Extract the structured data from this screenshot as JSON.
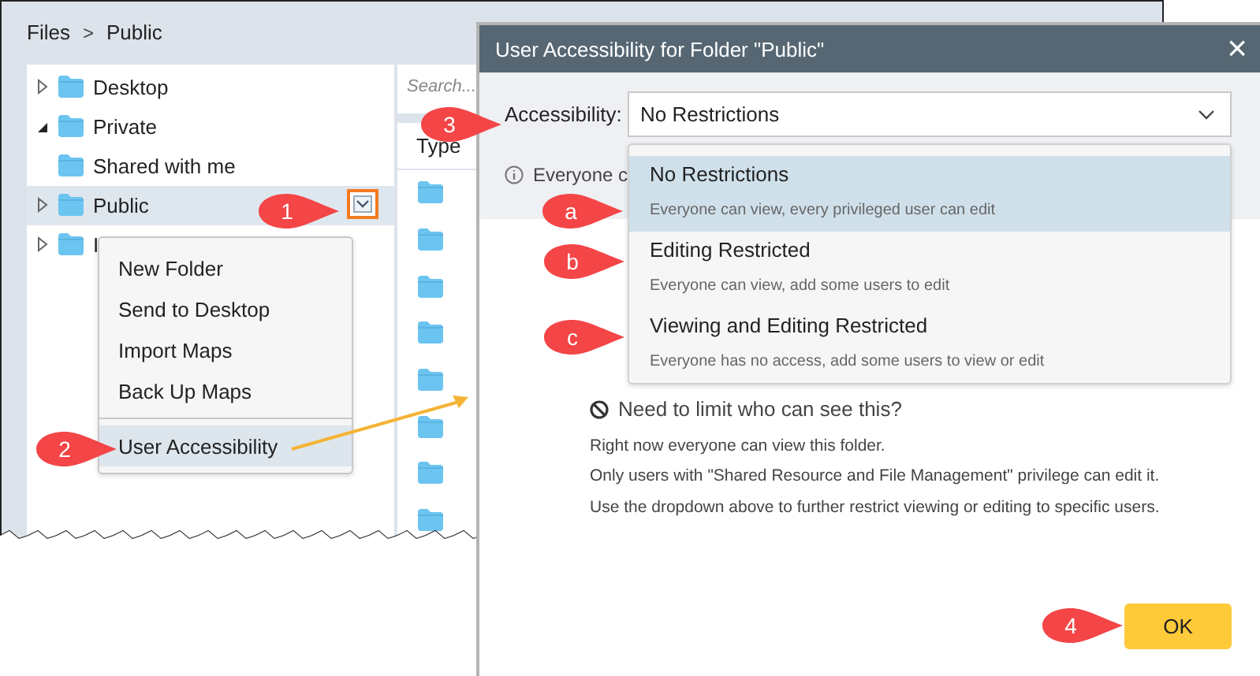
{
  "files_window": {
    "breadcrumb": [
      {
        "label": "Files"
      },
      {
        "label": ">",
        "kind": "separator"
      },
      {
        "label": "Public"
      }
    ],
    "tree": [
      {
        "label": "Desktop",
        "expanded": false,
        "selected": false
      },
      {
        "label": "Private",
        "expanded": true,
        "selected": false
      },
      {
        "label": "Shared with me",
        "selected": false
      },
      {
        "label": "Public",
        "expanded": false,
        "selected": true,
        "menu_button": true
      },
      {
        "label": "I",
        "expanded": false,
        "selected": false
      }
    ],
    "search": {
      "placeholder": "Search..."
    },
    "type_column": {
      "header": "Type",
      "rows": [
        {
          "kind": "folder"
        },
        {
          "kind": "folder"
        },
        {
          "kind": "folder"
        },
        {
          "kind": "folder"
        },
        {
          "kind": "folder"
        },
        {
          "kind": "folder"
        },
        {
          "kind": "folder"
        },
        {
          "kind": "folder"
        }
      ]
    },
    "context_menu": [
      {
        "kind": "item",
        "label": "New Folder",
        "selected": false
      },
      {
        "kind": "item",
        "label": "Send to Desktop",
        "selected": false
      },
      {
        "kind": "item",
        "label": "Import Maps",
        "selected": false
      },
      {
        "kind": "item",
        "label": "Back Up Maps",
        "selected": false
      },
      {
        "kind": "separator"
      },
      {
        "kind": "item",
        "label": "User Accessibility",
        "selected": true
      }
    ]
  },
  "dialog": {
    "title": "User Accessibility for Folder \"Public\"",
    "close": "×",
    "accessibility": {
      "label": "Accessibility:",
      "value": "No Restrictions"
    },
    "info": "Everyone c",
    "options": [
      {
        "title": "No Restrictions",
        "description": "Everyone can view, every privileged user can edit",
        "selected": true
      },
      {
        "title": "Editing Restricted",
        "description": "Everyone can view, add some users to edit",
        "selected": false
      },
      {
        "title": "Viewing and Editing Restricted",
        "description": "Everyone has no access, add some users to view or edit",
        "selected": false
      }
    ],
    "heading": "Need to limit who can see this?",
    "notes": [
      "Right now everyone can view this folder.",
      "Only users with \"Shared Resource and File Management\" privilege can edit it.",
      "Use the dropdown above to further restrict viewing or editing to specific users."
    ],
    "ok": "OK"
  },
  "callouts": [
    {
      "label": "1"
    },
    {
      "label": "2"
    },
    {
      "label": "3"
    },
    {
      "label": "a"
    },
    {
      "label": "b"
    },
    {
      "label": "c"
    },
    {
      "label": "4"
    }
  ]
}
